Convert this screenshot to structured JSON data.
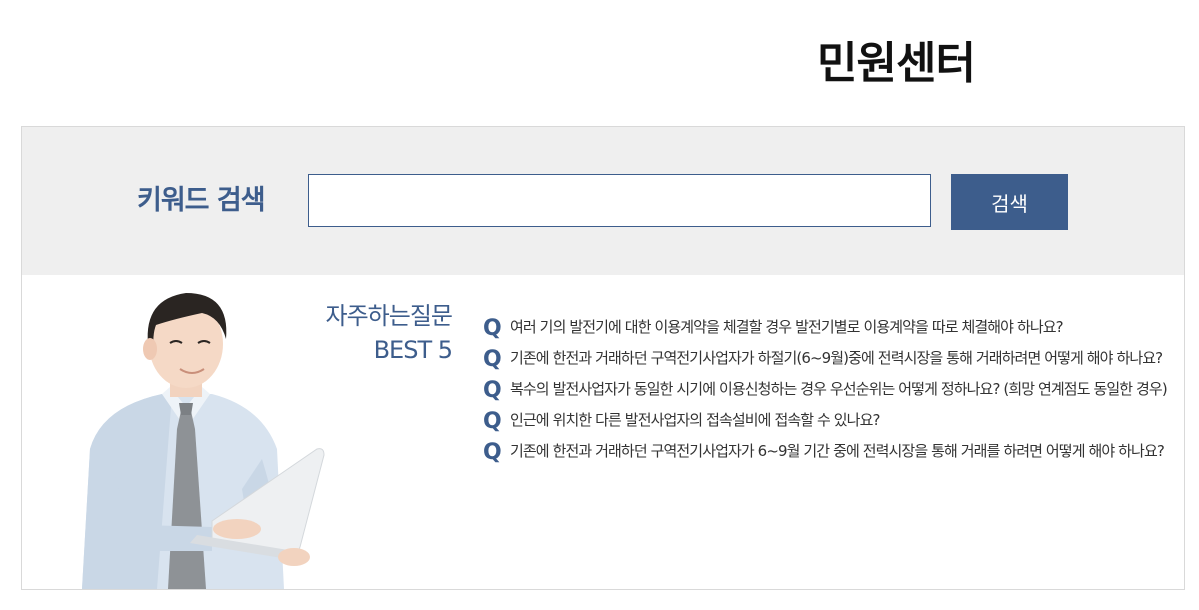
{
  "page_title": "민원센터",
  "search": {
    "label": "키워드 검색",
    "input_value": "",
    "button_label": "검색"
  },
  "faq": {
    "heading_line1": "자주하는질문",
    "heading_line2": "BEST 5",
    "marker": "Q",
    "items": [
      {
        "text": "여러 기의 발전기에 대한 이용계약을 체결할 경우 발전기별로 이용계약을 따로 체결해야 하나요?"
      },
      {
        "text": "기존에 한전과 거래하던 구역전기사업자가 하절기(6~9월)중에 전력시장을 통해 거래하려면 어떻게 해야 하나요?"
      },
      {
        "text": "복수의 발전사업자가 동일한 시기에 이용신청하는 경우 우선순위는 어떻게 정하나요? (희망 연계점도 동일한 경우)"
      },
      {
        "text": "인근에 위치한 다른 발전사업자의 접속설비에 접속할 수 있나요?"
      },
      {
        "text": "기존에 한전과 거래하던 구역전기사업자가 6~9월 기간 중에 전력시장을 통해 거래를 하려면 어떻게 해야 하나요?"
      }
    ]
  },
  "colors": {
    "accent": "#3d5d8c",
    "search_bg": "#efefef"
  },
  "icons": {
    "person": "businessman-with-laptop-illustration"
  }
}
